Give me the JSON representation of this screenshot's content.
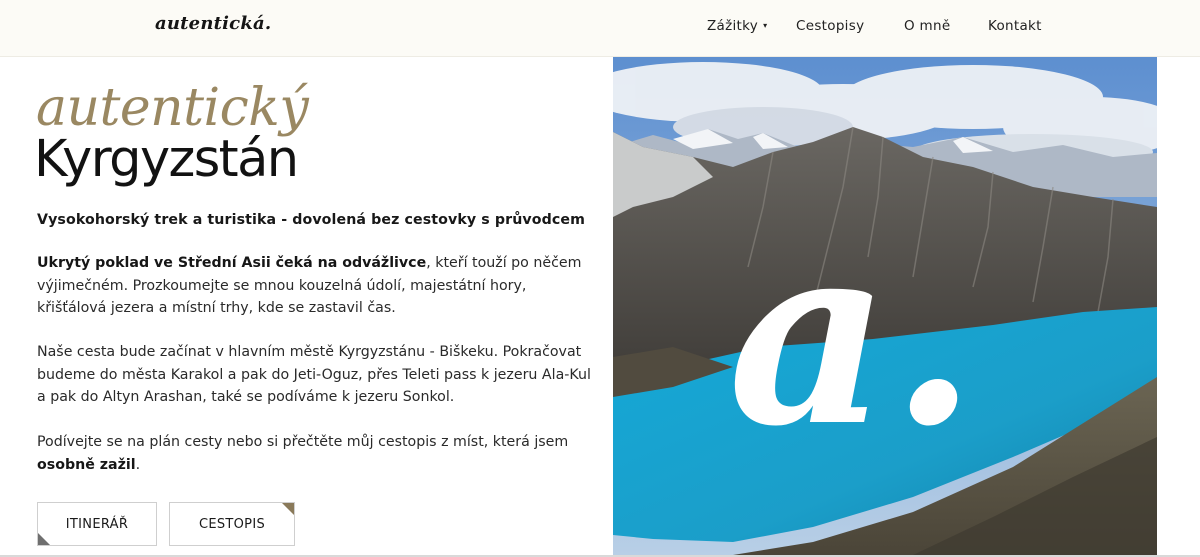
{
  "header": {
    "logo": "autentická.",
    "nav": [
      {
        "label": "Zážitky",
        "has_dropdown": true
      },
      {
        "label": "Cestopisy"
      },
      {
        "label": "O mně"
      },
      {
        "label": "Kontakt"
      }
    ],
    "dropdown_caret": "▾"
  },
  "hero": {
    "script_title": "autentický",
    "title": "Kyrgyzstán",
    "subtitle": "Vysokohorský trek a turistika - dovolená bez cestovky s průvodcem",
    "p1_bold": "Ukrytý poklad ve Střední Asii čeká na odvážlivce",
    "p1_rest": ", kteří touží po něčem výjimečném. Prozkoumejte se mnou kouzelná údolí, majestátní hory, křišťálová jezera a místní trhy, kde se zastavil čas.",
    "p2": "Naše cesta bude začínat v hlavním městě Kyrgyzstánu - Biškeku. Pokračovat budeme do města Karakol a pak do Jeti-Oguz, přes Teleti pass k jezeru Ala-Kul a pak do Altyn Arashan, také se podíváme k jezeru Sonkol.",
    "p3_text": "Podívejte se na plán cesty nebo si přečtěte můj cestopis z míst, která jsem ",
    "p3_bold": "osobně zažil",
    "p3_end": ".",
    "buttons": {
      "itinerary": "ITINERÁŘ",
      "travelogues": "CESTOPIS"
    },
    "image_overlay_letter": "a."
  },
  "colors": {
    "accent_gold": "#9a8862",
    "header_bg": "#fcfbf6",
    "lake": "#1fa6cf"
  }
}
